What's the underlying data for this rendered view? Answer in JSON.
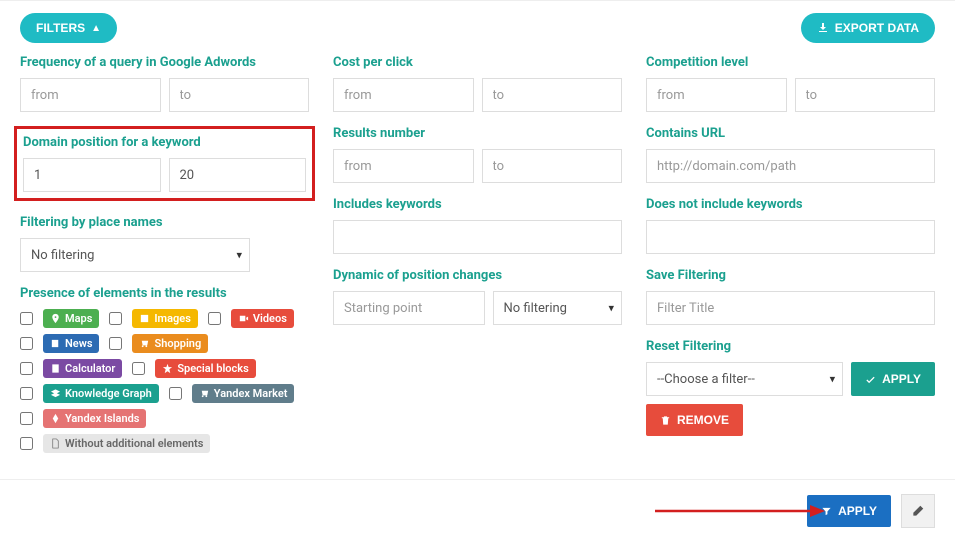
{
  "header": {
    "filters_label": "FILTERS",
    "export_label": "EXPORT DATA"
  },
  "col1": {
    "freq_label": "Frequency of a query in Google Adwords",
    "freq_from_ph": "from",
    "freq_to_ph": "to",
    "position_label": "Domain position for a keyword",
    "position_from_val": "1",
    "position_to_val": "20",
    "place_filter_label": "Filtering by place names",
    "place_filter_value": "No filtering",
    "presence_label": "Presence of elements in the results",
    "badges": {
      "maps": "Maps",
      "images": "Images",
      "videos": "Videos",
      "news": "News",
      "shopping": "Shopping",
      "calculator": "Calculator",
      "special_blocks": "Special blocks",
      "knowledge_graph": "Knowledge Graph",
      "yandex_market": "Yandex Market",
      "yandex_islands": "Yandex Islands",
      "without": "Without additional elements"
    }
  },
  "col2": {
    "cpc_label": "Cost per click",
    "cpc_from_ph": "from",
    "cpc_to_ph": "to",
    "results_label": "Results number",
    "results_from_ph": "from",
    "results_to_ph": "to",
    "includes_kw_label": "Includes keywords",
    "dynamic_label": "Dynamic of position changes",
    "starting_point_ph": "Starting point",
    "dynamic_filter_value": "No filtering"
  },
  "col3": {
    "competition_label": "Competition level",
    "comp_from_ph": "from",
    "comp_to_ph": "to",
    "contains_url_label": "Contains URL",
    "contains_url_ph": "http://domain.com/path",
    "not_include_kw_label": "Does not include keywords",
    "save_filtering_label": "Save Filtering",
    "filter_title_ph": "Filter Title",
    "reset_label": "Reset Filtering",
    "reset_select_value": "--Choose a filter--",
    "apply_btn": "APPLY",
    "remove_btn": "REMOVE"
  },
  "footer": {
    "apply_btn": "APPLY"
  }
}
